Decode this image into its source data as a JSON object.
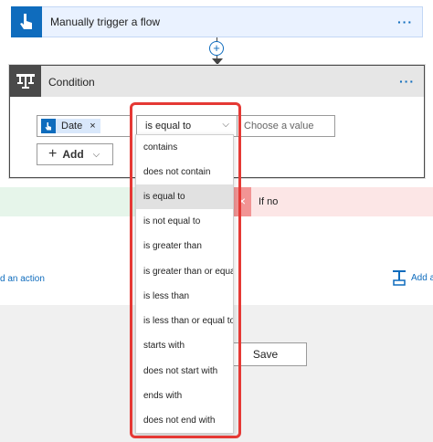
{
  "trigger": {
    "title": "Manually trigger a flow",
    "more": "···"
  },
  "connector": {
    "plus": "+"
  },
  "condition": {
    "title": "Condition",
    "more": "···",
    "token_label": "Date",
    "token_remove": "×",
    "operator_value": "is equal to",
    "value_placeholder": "Choose a value",
    "add_label": "Add"
  },
  "branches": {
    "no_label": "If no",
    "no_icon": "×"
  },
  "actions": {
    "add_action_left": "d an action",
    "add_action_right": "Add a"
  },
  "footer": {
    "save_label": "Save"
  },
  "dropdown": {
    "items": [
      "contains",
      "does not contain",
      "is equal to",
      "is not equal to",
      "is greater than",
      "is greater than or equal t",
      "is less than",
      "is less than or equal to",
      "starts with",
      "does not start with",
      "ends with",
      "does not end with"
    ],
    "selected_index": 2
  },
  "colors": {
    "accent": "#0f6cbd",
    "highlight": "#e53935",
    "yes_branch": "#e6f5ea",
    "no_branch": "#fce6e6"
  }
}
